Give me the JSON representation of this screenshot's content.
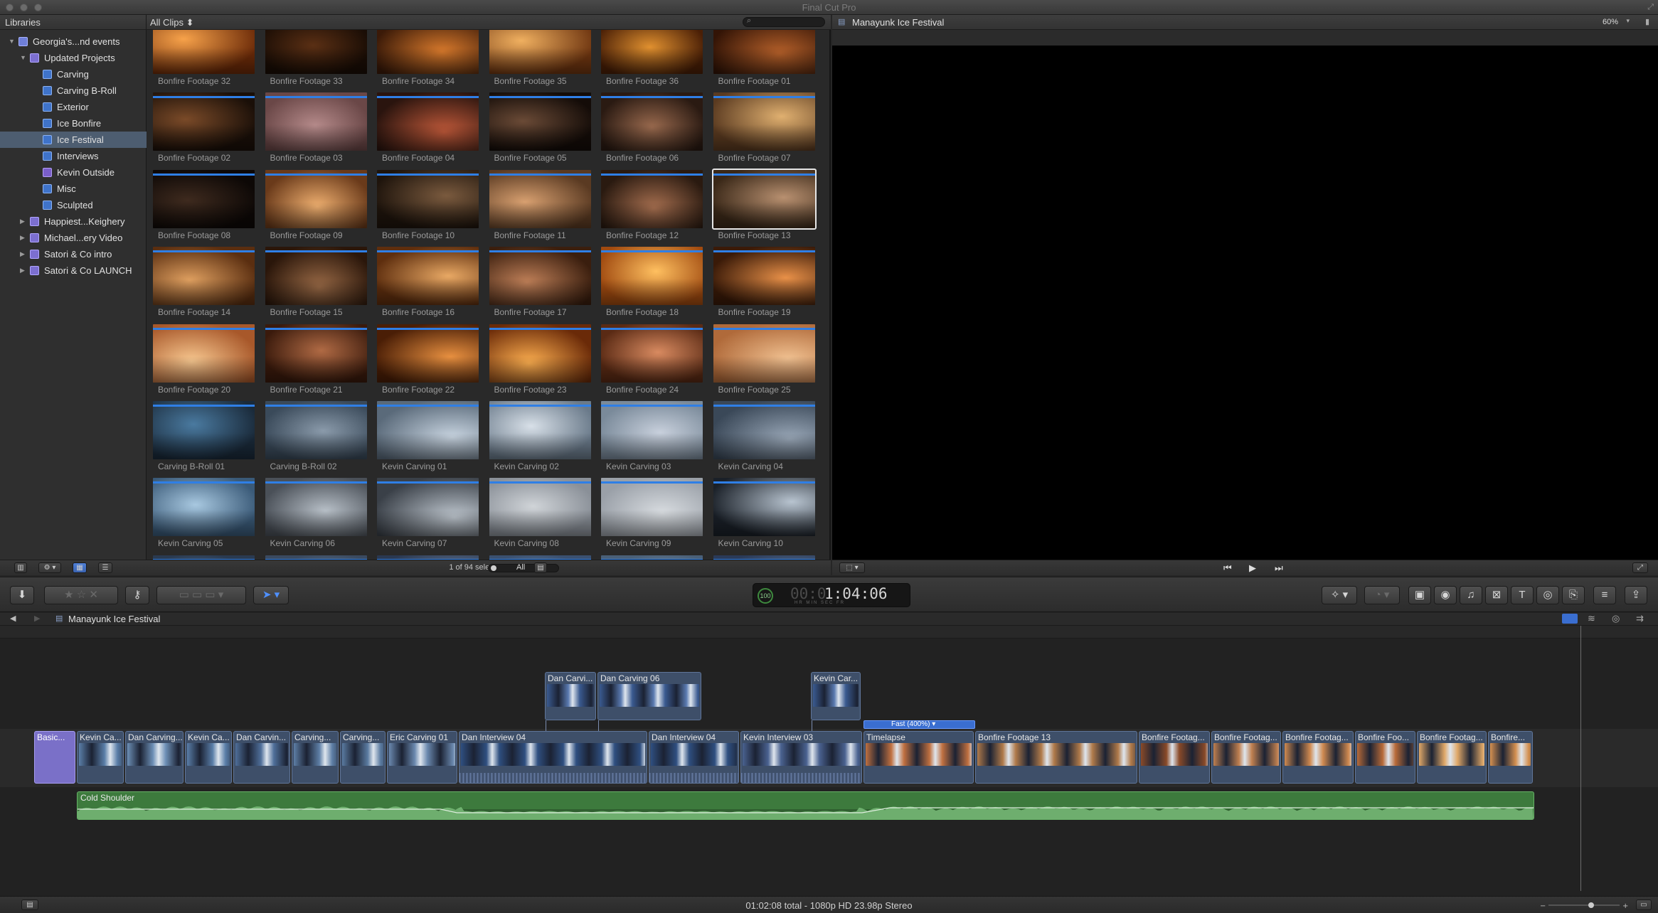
{
  "window": {
    "title": "Final Cut Pro"
  },
  "libraries": {
    "header": "Libraries",
    "items": [
      {
        "label": "Georgia's...nd events",
        "level": 0,
        "type": "lib",
        "disclosure": "open"
      },
      {
        "label": "Updated Projects",
        "level": 1,
        "type": "event",
        "disclosure": "open"
      },
      {
        "label": "Carving",
        "level": 2,
        "type": "proj"
      },
      {
        "label": "Carving B-Roll",
        "level": 2,
        "type": "proj"
      },
      {
        "label": "Exterior",
        "level": 2,
        "type": "proj"
      },
      {
        "label": "Ice Bonfire",
        "level": 2,
        "type": "proj"
      },
      {
        "label": "Ice Festival",
        "level": 2,
        "type": "proj",
        "selected": true
      },
      {
        "label": "Interviews",
        "level": 2,
        "type": "proj"
      },
      {
        "label": "Kevin Outside",
        "level": 2,
        "type": "proj-p"
      },
      {
        "label": "Misc",
        "level": 2,
        "type": "proj"
      },
      {
        "label": "Sculpted",
        "level": 2,
        "type": "proj"
      },
      {
        "label": "Happiest...Keighery",
        "level": 1,
        "type": "event",
        "disclosure": "closed"
      },
      {
        "label": "Michael...ery Video",
        "level": 1,
        "type": "event",
        "disclosure": "closed"
      },
      {
        "label": "Satori & Co intro",
        "level": 1,
        "type": "event",
        "disclosure": "closed"
      },
      {
        "label": "Satori & Co LAUNCH",
        "level": 1,
        "type": "event",
        "disclosure": "closed"
      }
    ]
  },
  "browser": {
    "filter": "All Clips ⬍",
    "status": "1 of 94 selected, 07:14",
    "zoom_label": "All",
    "clips": [
      {
        "label": "Bonfire Footage 32",
        "c1": "#f7a24a",
        "c2": "#6b2a08"
      },
      {
        "label": "Bonfire Footage 33",
        "c1": "#5a2f14",
        "c2": "#1a0d05"
      },
      {
        "label": "Bonfire Footage 34",
        "c1": "#d97a2c",
        "c2": "#3b1a08"
      },
      {
        "label": "Bonfire Footage 35",
        "c1": "#f0b060",
        "c2": "#6e3510"
      },
      {
        "label": "Bonfire Footage 36",
        "c1": "#e0902f",
        "c2": "#4a1f06"
      },
      {
        "label": "Bonfire Footage 01",
        "c1": "#b7612a",
        "c2": "#331406"
      },
      {
        "label": "Bonfire Footage 02",
        "c1": "#7a4a28",
        "c2": "#1a0f08"
      },
      {
        "label": "Bonfire Footage 03",
        "c1": "#b58a8a",
        "c2": "#6a4747"
      },
      {
        "label": "Bonfire Footage 04",
        "c1": "#c25a3a",
        "c2": "#2a140e"
      },
      {
        "label": "Bonfire Footage 05",
        "c1": "#6a4a36",
        "c2": "#140c08"
      },
      {
        "label": "Bonfire Footage 06",
        "c1": "#9a6a4e",
        "c2": "#2a1a12"
      },
      {
        "label": "Bonfire Footage 07",
        "c1": "#e0b070",
        "c2": "#5a3a20"
      },
      {
        "label": "Bonfire Footage 08",
        "c1": "#3e2a1e",
        "c2": "#0d0806"
      },
      {
        "label": "Bonfire Footage 09",
        "c1": "#f0b070",
        "c2": "#6a3a1a"
      },
      {
        "label": "Bonfire Footage 10",
        "c1": "#7a5a3e",
        "c2": "#1e140c"
      },
      {
        "label": "Bonfire Footage 11",
        "c1": "#d8a070",
        "c2": "#5a3a22"
      },
      {
        "label": "Bonfire Footage 12",
        "c1": "#a87050",
        "c2": "#2a1a10"
      },
      {
        "label": "Bonfire Footage 13",
        "c1": "#b89070",
        "c2": "#3a2818",
        "selected": true
      },
      {
        "label": "Bonfire Footage 14",
        "c1": "#e0a060",
        "c2": "#5a2e10"
      },
      {
        "label": "Bonfire Footage 15",
        "c1": "#9a6a46",
        "c2": "#2a160a"
      },
      {
        "label": "Bonfire Footage 16",
        "c1": "#e8a864",
        "c2": "#5e2e0e"
      },
      {
        "label": "Bonfire Footage 17",
        "c1": "#c08058",
        "c2": "#3a1e0e"
      },
      {
        "label": "Bonfire Footage 18",
        "c1": "#ffc060",
        "c2": "#a04a10"
      },
      {
        "label": "Bonfire Footage 19",
        "c1": "#e89048",
        "c2": "#3a1a08"
      },
      {
        "label": "Bonfire Footage 20",
        "c1": "#f8c890",
        "c2": "#a8582a"
      },
      {
        "label": "Bonfire Footage 21",
        "c1": "#b06a44",
        "c2": "#3a1a0c"
      },
      {
        "label": "Bonfire Footage 22",
        "c1": "#e89040",
        "c2": "#4a1e06"
      },
      {
        "label": "Bonfire Footage 23",
        "c1": "#ffb050",
        "c2": "#6a2a08"
      },
      {
        "label": "Bonfire Footage 24",
        "c1": "#d88a60",
        "c2": "#5a2a14"
      },
      {
        "label": "Bonfire Footage 25",
        "c1": "#f0c090",
        "c2": "#b06a3a"
      },
      {
        "label": "Carving B-Roll 01",
        "c1": "#4a7aa0",
        "c2": "#1a2a3a"
      },
      {
        "label": "Carving B-Roll 02",
        "c1": "#8a9aaa",
        "c2": "#3a4a5a"
      },
      {
        "label": "Kevin Carving 01",
        "c1": "#c8d4e0",
        "c2": "#5a6a7a"
      },
      {
        "label": "Kevin Carving 02",
        "c1": "#d8e0e8",
        "c2": "#6a7a8a"
      },
      {
        "label": "Kevin Carving 03",
        "c1": "#c8d0dc",
        "c2": "#7a8a9a"
      },
      {
        "label": "Kevin Carving 04",
        "c1": "#9aa8b8",
        "c2": "#3a4858"
      },
      {
        "label": "Kevin Carving 05",
        "c1": "#a8c8e0",
        "c2": "#3a5a78"
      },
      {
        "label": "Kevin Carving 06",
        "c1": "#b8c0c8",
        "c2": "#4a5058"
      },
      {
        "label": "Kevin Carving 07",
        "c1": "#c0c8d0",
        "c2": "#3a4048"
      },
      {
        "label": "Kevin Carving 08",
        "c1": "#d0d4d8",
        "c2": "#8a9098"
      },
      {
        "label": "Kevin Carving 09",
        "c1": "#d8dce0",
        "c2": "#9aa0a8"
      },
      {
        "label": "Kevin Carving 10",
        "c1": "#b8c4d0",
        "c2": "#1a2028"
      },
      {
        "label": "",
        "c1": "#6a8ab0",
        "c2": "#2a3a50"
      },
      {
        "label": "",
        "c1": "#8aa0b8",
        "c2": "#3a4a60"
      },
      {
        "label": "",
        "c1": "#7a90b0",
        "c2": "#2a3850"
      },
      {
        "label": "",
        "c1": "#8aa8c8",
        "c2": "#3a5070"
      },
      {
        "label": "",
        "c1": "#9ab0c8",
        "c2": "#4a6078"
      },
      {
        "label": "",
        "c1": "#7a98b8",
        "c2": "#2a3a58"
      }
    ]
  },
  "viewer": {
    "title": "Manayunk Ice Festival",
    "zoom": "60%"
  },
  "toolbar": {
    "timecode": "1:04:06",
    "timecode_dim": "00:0",
    "rate": "100",
    "units": "HR MIN SEC FR"
  },
  "timeline": {
    "project": "Manayunk Ice Festival",
    "retime_label": "Fast (400%) ▾",
    "title_clip": "Basic...",
    "connected": [
      {
        "name": "Dan Carvi..."
      },
      {
        "name": "Dan Carving 06"
      },
      {
        "name": "Kevin Car..."
      }
    ],
    "primary": [
      {
        "name": "Kevin Ca..."
      },
      {
        "name": "Dan Carving..."
      },
      {
        "name": "Kevin Ca..."
      },
      {
        "name": "Dan Carvin..."
      },
      {
        "name": "Carving..."
      },
      {
        "name": "Carving..."
      },
      {
        "name": "Eric Carving 01"
      },
      {
        "name": "Dan Interview 04"
      },
      {
        "name": "Dan Interview 04"
      },
      {
        "name": "Kevin Interview 03"
      },
      {
        "name": "Timelapse"
      },
      {
        "name": "Bonfire Footage 13"
      },
      {
        "name": "Bonfire Footag..."
      },
      {
        "name": "Bonfire Footag..."
      },
      {
        "name": "Bonfire Footag..."
      },
      {
        "name": "Bonfire Foo..."
      },
      {
        "name": "Bonfire Footag..."
      },
      {
        "name": "Bonfire..."
      }
    ],
    "audio": "Cold Shoulder"
  },
  "status": {
    "summary": "01:02:08 total - 1080p HD 23.98p Stereo"
  }
}
